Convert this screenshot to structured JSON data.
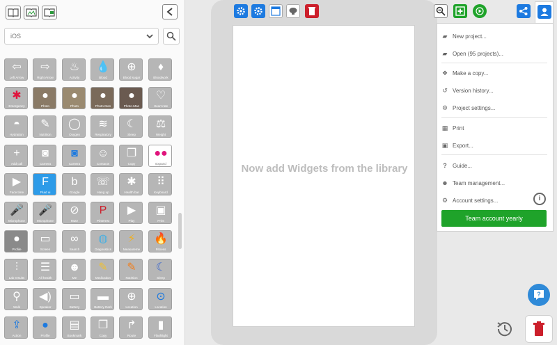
{
  "sidebar": {
    "library_value": "iOS",
    "toolbar_icons": [
      "book-icon",
      "map-book-icon",
      "image-book-icon"
    ],
    "widgets": [
      {
        "label": "Left Arrow",
        "glyph": "⇦",
        "color": "#b6b6b6"
      },
      {
        "label": "Right Arrow",
        "glyph": "⇨",
        "color": "#b6b6b6"
      },
      {
        "label": "Activity",
        "glyph": "♨",
        "color": "#b6b6b6"
      },
      {
        "label": "Blood",
        "glyph": "💧",
        "color": "#b6b6b6"
      },
      {
        "label": "Blood sugar",
        "glyph": "⊕",
        "color": "#b6b6b6"
      },
      {
        "label": "Bloodwork",
        "glyph": "♦",
        "color": "#b6b6b6"
      },
      {
        "label": "Emergency",
        "glyph": "✱",
        "color": "#b6b6b6",
        "glyph_color": "#e0143c"
      },
      {
        "label": "Photo",
        "glyph": "●",
        "color": "#8a7a66"
      },
      {
        "label": "Photo",
        "glyph": "●",
        "color": "#9a8a70"
      },
      {
        "label": "Photo-Man",
        "glyph": "●",
        "color": "#7a6a5a"
      },
      {
        "label": "Photo-Man",
        "glyph": "●",
        "color": "#6a5a50"
      },
      {
        "label": "Heart rate",
        "glyph": "♡",
        "color": "#b6b6b6"
      },
      {
        "label": "Hydration",
        "glyph": "◓",
        "color": "#b6b6b6"
      },
      {
        "label": "Nutrition",
        "glyph": "✎",
        "color": "#b6b6b6"
      },
      {
        "label": "Oxygen",
        "glyph": "◯",
        "color": "#b6b6b6"
      },
      {
        "label": "Respiratory",
        "glyph": "≋",
        "color": "#b6b6b6"
      },
      {
        "label": "Sleep",
        "glyph": "☾",
        "color": "#b6b6b6"
      },
      {
        "label": "Weight",
        "glyph": "⚖",
        "color": "#b6b6b6"
      },
      {
        "label": "Add call",
        "glyph": "+",
        "color": "#b6b6b6"
      },
      {
        "label": "Camera",
        "glyph": "◙",
        "color": "#b6b6b6"
      },
      {
        "label": "Camera",
        "glyph": "◙",
        "color": "#b6b6b6",
        "glyph_color": "#1d7ae0"
      },
      {
        "label": "Contacts",
        "glyph": "☺",
        "color": "#b6b6b6"
      },
      {
        "label": "Copy",
        "glyph": "❐",
        "color": "#b6b6b6"
      },
      {
        "label": "Expand",
        "glyph": "●●",
        "color": "#ffffff",
        "glyph_color": "#e0147c"
      },
      {
        "label": "Face time",
        "glyph": "▶",
        "color": "#b6b6b6"
      },
      {
        "label": "Fluid ui",
        "glyph": "F",
        "color": "#2d9be8"
      },
      {
        "label": "Google",
        "glyph": "b",
        "color": "#b6b6b6"
      },
      {
        "label": "Hang up",
        "glyph": "☏",
        "color": "#b6b6b6"
      },
      {
        "label": "Health bar",
        "glyph": "✱",
        "color": "#b6b6b6"
      },
      {
        "label": "Keyboard",
        "glyph": "⠿",
        "color": "#b6b6b6"
      },
      {
        "label": "Microphone",
        "glyph": "🎤",
        "color": "#b6b6b6"
      },
      {
        "label": "Microphone",
        "glyph": "🎤",
        "color": "#b6b6b6",
        "glyph_color": "#1d7ae0"
      },
      {
        "label": "Mute",
        "glyph": "⊘",
        "color": "#b6b6b6"
      },
      {
        "label": "Pinterest",
        "glyph": "P",
        "color": "#b6b6b6",
        "glyph_color": "#cc1f2b"
      },
      {
        "label": "Play",
        "glyph": "▶",
        "color": "#b6b6b6"
      },
      {
        "label": "Print",
        "glyph": "▣",
        "color": "#b6b6b6"
      },
      {
        "label": "Profile",
        "glyph": "●",
        "color": "#8a8a8a"
      },
      {
        "label": "Screen",
        "glyph": "▭",
        "color": "#b6b6b6"
      },
      {
        "label": "Search",
        "glyph": "∞",
        "color": "#b6b6b6"
      },
      {
        "label": "Diagnostics",
        "glyph": "◍",
        "color": "#b6b6b6",
        "glyph_color": "#4db0e0"
      },
      {
        "label": "Measureme",
        "glyph": "⚡",
        "color": "#b6b6b6",
        "glyph_color": "#f0b020"
      },
      {
        "label": "Fitness",
        "glyph": "🔥",
        "color": "#b6b6b6",
        "glyph_color": "#f04020"
      },
      {
        "label": "Lab results",
        "glyph": "⫶",
        "color": "#b6b6b6"
      },
      {
        "label": "All health",
        "glyph": "☰",
        "color": "#b6b6b6"
      },
      {
        "label": "Me",
        "glyph": "☻",
        "color": "#b6b6b6"
      },
      {
        "label": "Medication",
        "glyph": "✎",
        "color": "#b6b6b6",
        "glyph_color": "#f0c030"
      },
      {
        "label": "Nutrition",
        "glyph": "✎",
        "color": "#b6b6b6",
        "glyph_color": "#f08020"
      },
      {
        "label": "Sleep",
        "glyph": "☾",
        "color": "#b6b6b6",
        "glyph_color": "#3060d0"
      },
      {
        "label": "Walk",
        "glyph": "⚲",
        "color": "#b6b6b6"
      },
      {
        "label": "Speaker",
        "glyph": "◀)",
        "color": "#b6b6b6"
      },
      {
        "label": "Battery",
        "glyph": "▭",
        "color": "#b6b6b6"
      },
      {
        "label": "Battery Dark",
        "glyph": "▬",
        "color": "#b6b6b6"
      },
      {
        "label": "Location",
        "glyph": "⊕",
        "color": "#b6b6b6"
      },
      {
        "label": "Location",
        "glyph": "⊙",
        "color": "#b6b6b6",
        "glyph_color": "#1d7ae0"
      },
      {
        "label": "Action",
        "glyph": "⇪",
        "color": "#b6b6b6",
        "glyph_color": "#1d7ae0"
      },
      {
        "label": "Profile",
        "glyph": "●",
        "color": "#b6b6b6",
        "glyph_color": "#1d7ae0"
      },
      {
        "label": "Bookmark",
        "glyph": "▤",
        "color": "#b6b6b6"
      },
      {
        "label": "Copy",
        "glyph": "❐",
        "color": "#b6b6b6"
      },
      {
        "label": "Route",
        "glyph": "↱",
        "color": "#b6b6b6"
      },
      {
        "label": "Flashlight",
        "glyph": "▮",
        "color": "#b6b6b6"
      }
    ]
  },
  "canvas": {
    "placeholder": "Now add Widgets from the library",
    "toolbar_icons": [
      "settings-icon",
      "page-settings-icon",
      "layout-icon",
      "brain-icon",
      "trash-icon"
    ]
  },
  "menu": {
    "items": [
      {
        "label": "New project...",
        "icon": "folder-plus-icon",
        "glyph": "▰"
      },
      {
        "label": "Open (95 projects)...",
        "icon": "folder-open-icon",
        "glyph": "▰"
      },
      {
        "label": "Make a copy...",
        "icon": "copy-icon",
        "glyph": "❖"
      },
      {
        "label": "Version history...",
        "icon": "history-icon",
        "glyph": "↺"
      },
      {
        "label": "Project settings...",
        "icon": "gear-icon",
        "glyph": "⚙"
      },
      {
        "label": "Print",
        "icon": "print-icon",
        "glyph": "▦"
      },
      {
        "label": "Export...",
        "icon": "export-icon",
        "glyph": "▣"
      },
      {
        "label": "Guide...",
        "icon": "question-icon",
        "glyph": "?"
      },
      {
        "label": "Team management...",
        "icon": "team-icon",
        "glyph": "☻"
      },
      {
        "label": "Account settings...",
        "icon": "gear-icon",
        "glyph": "⚙"
      }
    ],
    "team_button": "Team account yearly",
    "info_glyph": "i"
  },
  "colors": {
    "accent_blue": "#1d7ae0",
    "green": "#1fa32a",
    "red": "#cc1f2b"
  }
}
